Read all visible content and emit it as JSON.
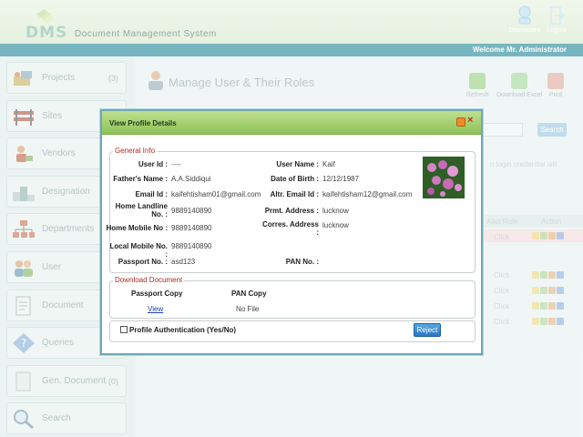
{
  "app": {
    "logo_text": "DMS",
    "title": "Document Management System",
    "welcome": "Welcome Mr. Administrator",
    "dashboard_label": "Dashboard",
    "logout_label": "Logout"
  },
  "sidebar": {
    "items": [
      {
        "label": "Projects",
        "count": "(3)"
      },
      {
        "label": "Sites",
        "count": ""
      },
      {
        "label": "Vendors",
        "count": ""
      },
      {
        "label": "Designation",
        "count": ""
      },
      {
        "label": "Departments",
        "count": ""
      },
      {
        "label": "User",
        "count": ""
      },
      {
        "label": "Document",
        "count": ""
      },
      {
        "label": "Queries",
        "count": ""
      },
      {
        "label": "Gen. Document",
        "count": "(0)"
      },
      {
        "label": "Search",
        "count": ""
      }
    ]
  },
  "page": {
    "title": "Manage User & Their Roles",
    "toolbar": {
      "refresh": "Refresh",
      "download_excel": "Download Excel",
      "print": "Print"
    },
    "search_label": "Search",
    "hint_text": "n login credential will",
    "col_allot_role": "Allot Role",
    "col_action": "Action",
    "click_text": "Click"
  },
  "modal": {
    "title": "View Profile Details",
    "general_legend": "General Info",
    "fields": {
      "user_id_label": "User Id :",
      "user_id_value": "----",
      "user_name_label": "User Name :",
      "user_name_value": "Kaif",
      "father_label": "Father's Name :",
      "father_value": "A.A.Siddiqui",
      "dob_label": "Date of Birth :",
      "dob_value": "12/12/1987",
      "email_label": "Email Id :",
      "email_value": "kaifehtisham01@gmail.com",
      "altr_email_label": "Altr. Email Id :",
      "altr_email_value": "kaifehtisham12@gmail.com",
      "home_landline_label_1": "Home Landline",
      "home_landline_label_2": "No. :",
      "home_landline_value": "9889140890",
      "prmt_address_label": "Prmt. Address :",
      "prmt_address_value": "lucknow",
      "home_mobile_label": "Home Mobile No :",
      "home_mobile_value": "9889140890",
      "corres_address_label_1": "Corres. Address",
      "corres_address_label_2": ":",
      "corres_address_value": "lucknow",
      "local_mobile_label": "Local Mobile No. :",
      "local_mobile_value": "9889140890",
      "passport_label": "Passport No. :",
      "passport_value": "asd123",
      "pan_label": "PAN No. :",
      "pan_value": ""
    },
    "download_legend": "Download Document",
    "passport_copy_label": "Passport Copy",
    "pan_copy_label": "PAN Copy",
    "view_link": "View",
    "no_file": "No File",
    "auth_label": "Profile Authentication (Yes/No)",
    "reject_label": "Reject"
  }
}
